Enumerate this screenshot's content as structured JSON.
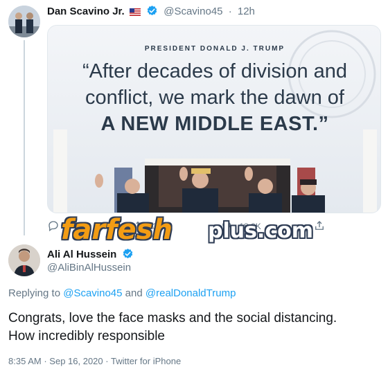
{
  "tweet1": {
    "author_name": "Dan Scavino Jr.",
    "handle": "@Scavino45",
    "separator": "·",
    "time": "12h",
    "media": {
      "caption": "PRESIDENT DONALD J. TRUMP",
      "quote_line1": "“After decades of division and",
      "quote_line2": "conflict, we mark the dawn of",
      "quote_line3": "A NEW MIDDLE EAST.”"
    },
    "actions": {
      "reply_icon": "reply-icon",
      "retweet_icon": "retweet-icon",
      "retweet_count": "3K",
      "like_icon": "heart-icon",
      "like_count": "18.2K",
      "share_icon": "share-icon"
    }
  },
  "watermark": {
    "main": "farfesh",
    "sub": "plus.com"
  },
  "tweet2": {
    "author_name": "Ali Al Hussein",
    "handle": "@AliBinAlHussein",
    "replying_prefix": "Replying to",
    "replying_to_1": "@Scavino45",
    "replying_and": "and",
    "replying_to_2": "@realDonaldTrump",
    "text_line1": "Congrats, love the face masks and the social distancing.",
    "text_line2": "How incredibly responsible",
    "time": "8:35 AM",
    "date": "Sep 16, 2020",
    "separator": "·",
    "source": "Twitter for iPhone"
  },
  "colors": {
    "link": "#1da1f2",
    "muted": "#657786",
    "text": "#14171a",
    "watermark_orange": "#f29c14"
  }
}
